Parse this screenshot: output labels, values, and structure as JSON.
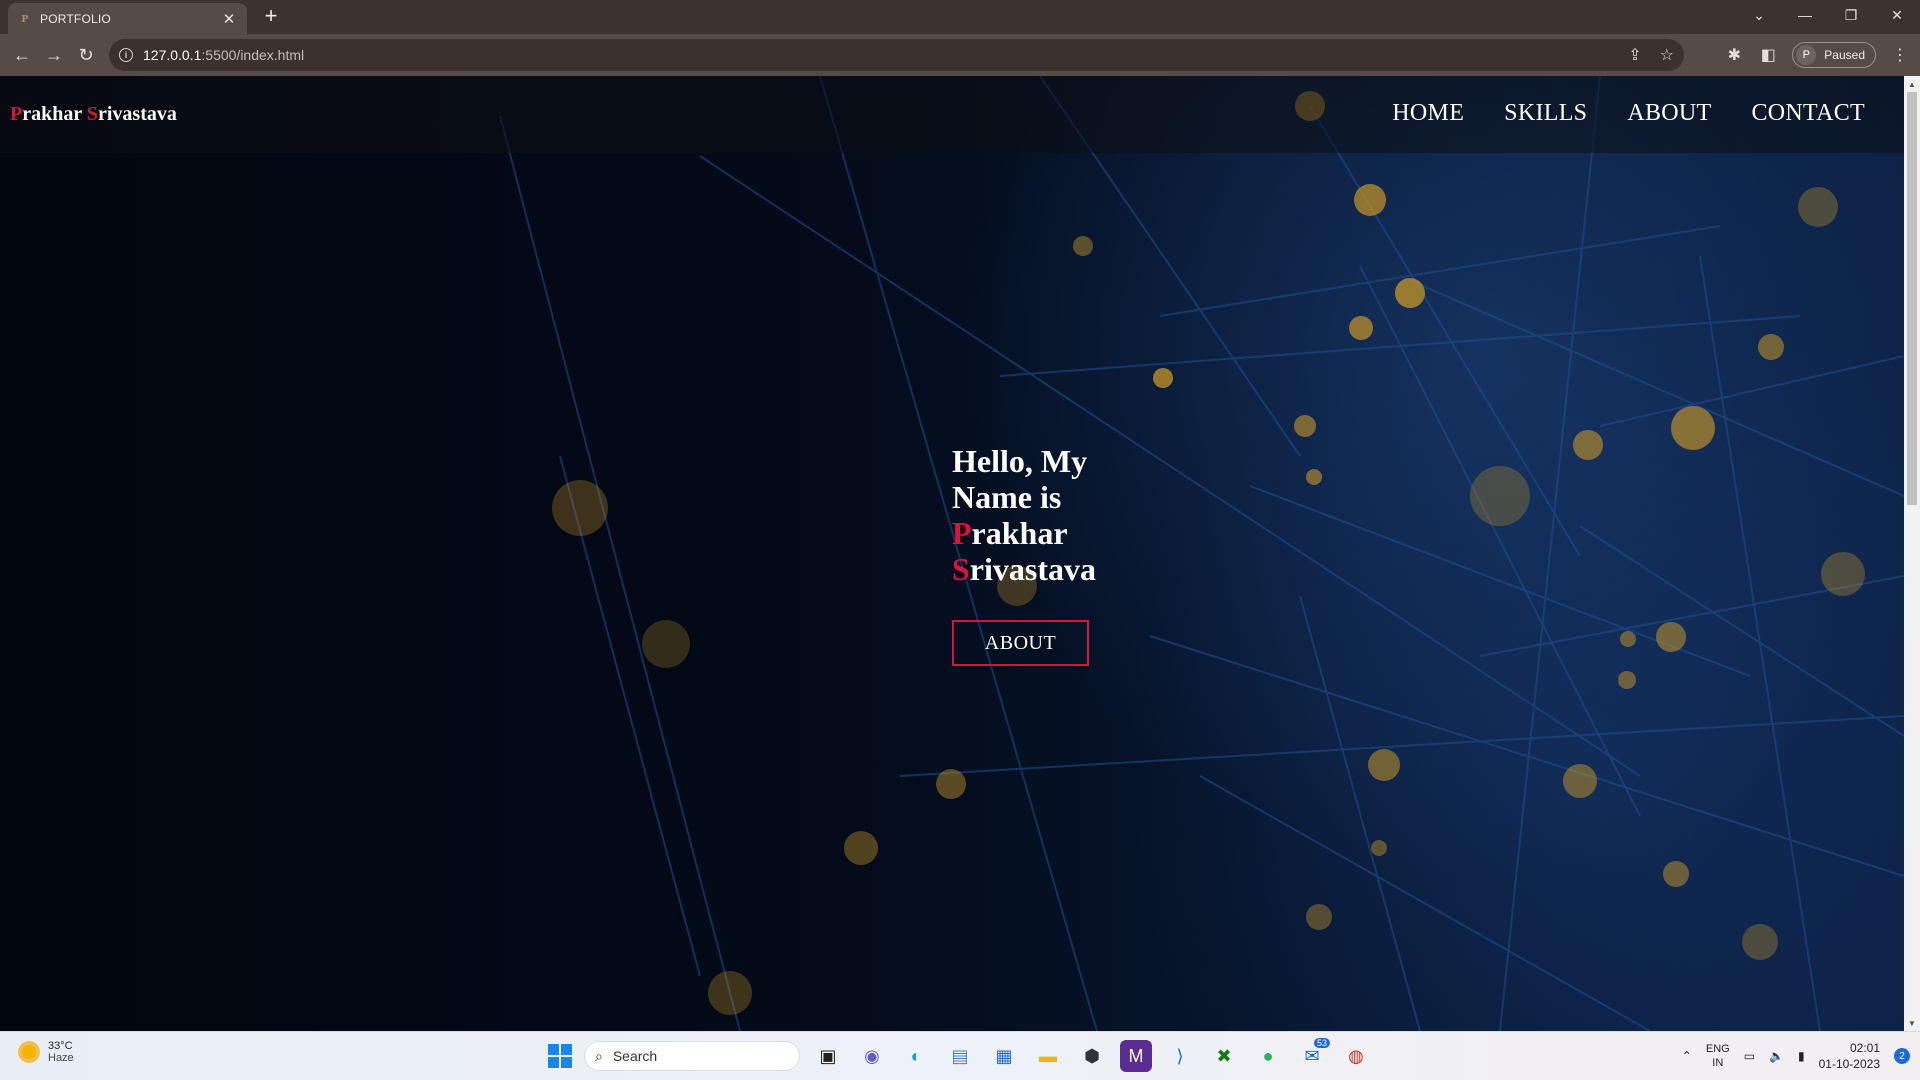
{
  "browser": {
    "tab_title": "PORTFOLIO",
    "tab_favicon": "P",
    "tab_close": "✕",
    "new_tab": "+",
    "url_host": "127.0.0.1",
    "url_rest": ":5500/index.html",
    "profile_initial": "P",
    "profile_status": "Paused"
  },
  "site": {
    "brand_first_initial": "P",
    "brand_first_rest": "rakhar ",
    "brand_last_initial": "S",
    "brand_last_rest": "rivastava",
    "nav": [
      "HOME",
      "SKILLS",
      "ABOUT",
      "CONTACT"
    ],
    "hero_line1": "Hello, My",
    "hero_line2": "Name is",
    "hero_first_initial": "P",
    "hero_first_rest": "rakhar",
    "hero_last_initial": "S",
    "hero_last_rest": "rivastava",
    "hero_button": "ABOUT",
    "accent_color": "#dc143c"
  },
  "taskbar": {
    "temperature": "33°C",
    "weather": "Haze",
    "search_placeholder": "Search",
    "outlook_badge": "53",
    "lang_line1": "ENG",
    "lang_line2": "IN",
    "time": "02:01",
    "date": "01-10-2023",
    "notification_count": "2"
  }
}
